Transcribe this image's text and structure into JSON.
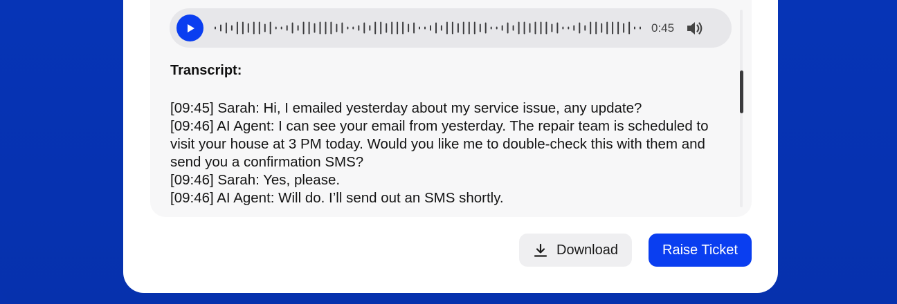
{
  "player": {
    "duration": "0:45",
    "play_icon": "play-icon",
    "volume_icon": "volume-icon",
    "waveform_heights": [
      4,
      10,
      16,
      8,
      18,
      18,
      14,
      18,
      18,
      12,
      18,
      4,
      4,
      8,
      16,
      8,
      18,
      18,
      14,
      18,
      18,
      18,
      12,
      16,
      4,
      4,
      8,
      16,
      8,
      18,
      18,
      14,
      18,
      18,
      18,
      12,
      16,
      4,
      4,
      8,
      16,
      8,
      18,
      18,
      14,
      18,
      18,
      18,
      12,
      16,
      4,
      4,
      8,
      16,
      8,
      18,
      18,
      14,
      18,
      18,
      18,
      12,
      16,
      4,
      4,
      8,
      16,
      8,
      18,
      18,
      14,
      18,
      18,
      18,
      14,
      18,
      4,
      4
    ]
  },
  "transcript": {
    "title": "Transcript:",
    "lines": [
      "[09:45] Sarah: Hi, I emailed yesterday about my service issue, any update?",
      "[09:46] AI Agent: I can see your email from yesterday. The repair team is scheduled to visit your house at 3 PM today. Would you like me to double-check this with them and send you a confirmation SMS?",
      "[09:46] Sarah: Yes, please.",
      "[09:46] AI Agent: Will do. I’ll send out an SMS shortly."
    ]
  },
  "actions": {
    "download_label": "Download",
    "download_icon": "download-icon",
    "raise_ticket_label": "Raise Ticket"
  },
  "colors": {
    "background": "#0631ae",
    "accent": "#0a3ef0",
    "card": "#ffffff",
    "panel": "#f7f7f8",
    "player": "#e7e7ea"
  }
}
